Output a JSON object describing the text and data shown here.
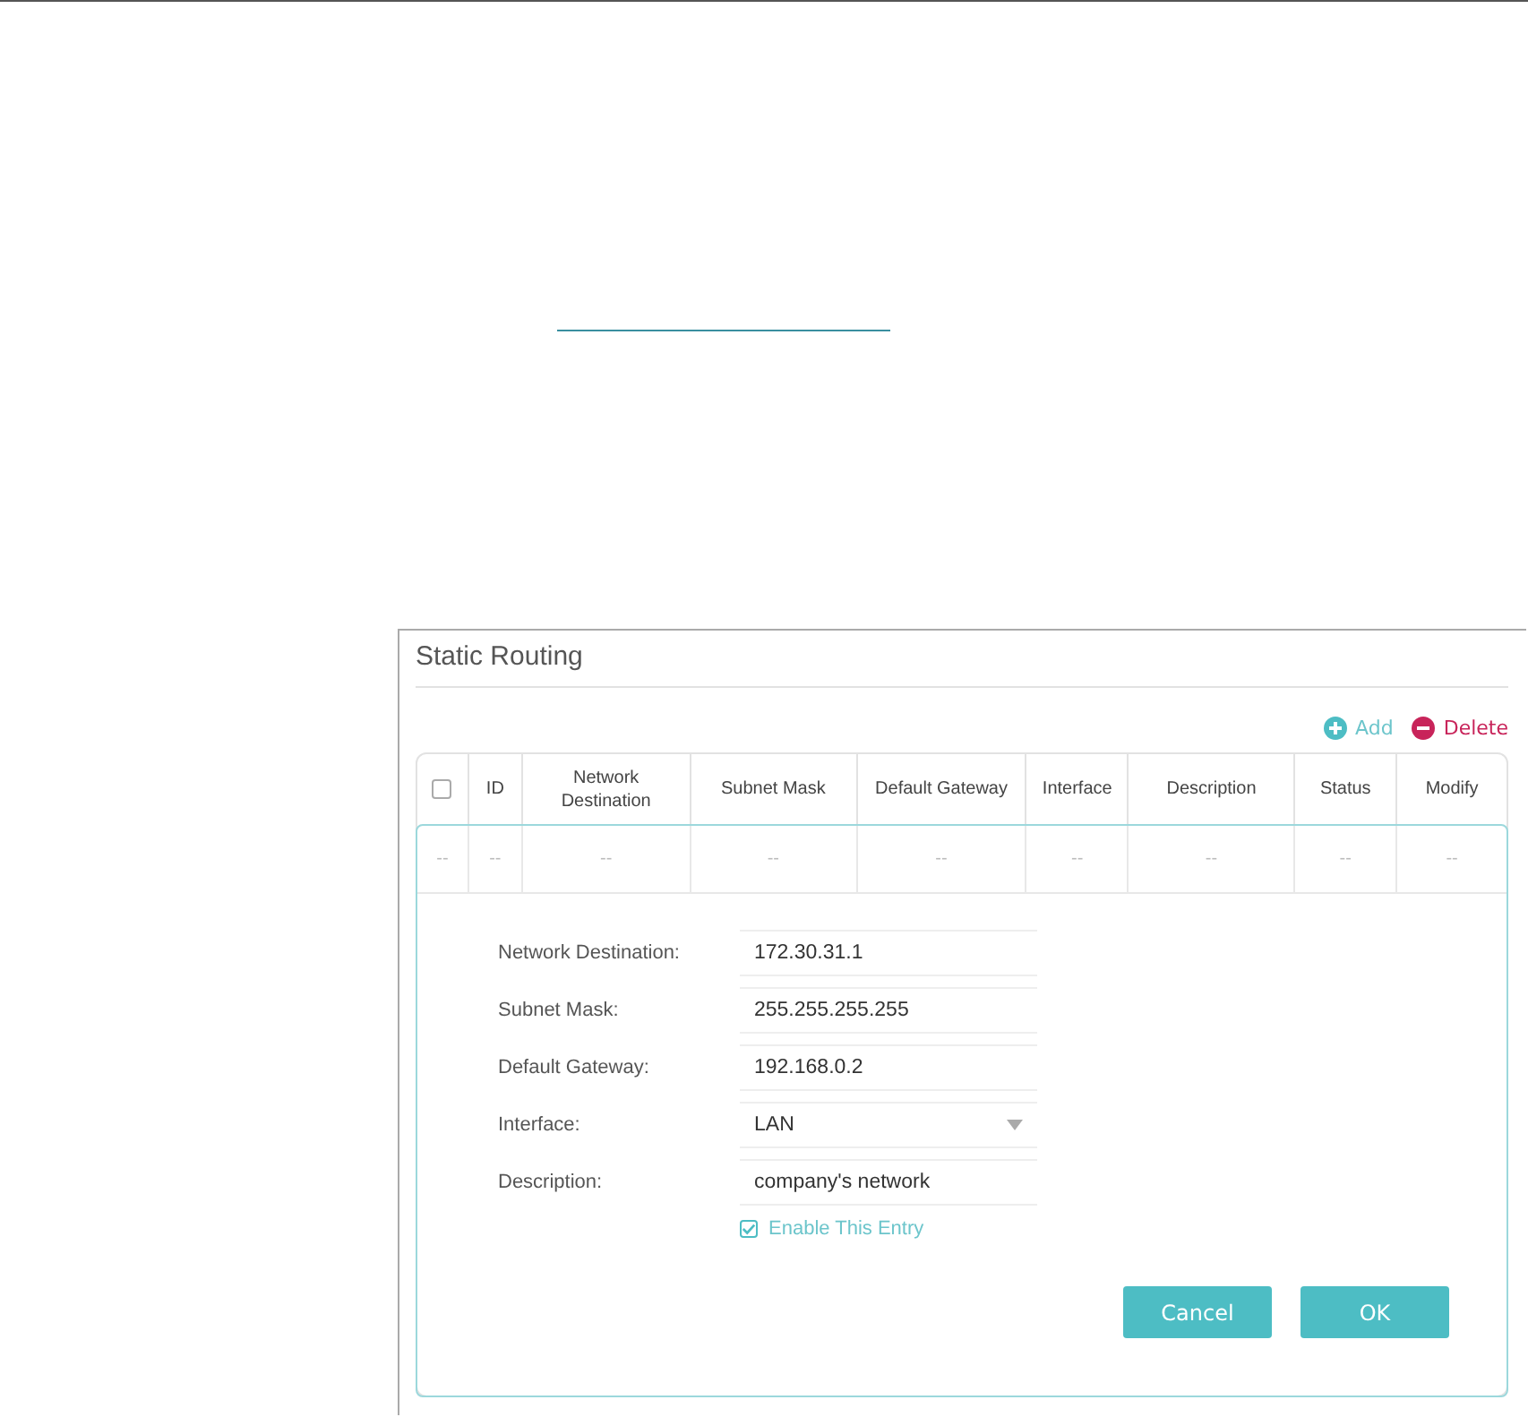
{
  "title": "Static Routing",
  "actions": [
    {
      "label": "Add",
      "kind": "add"
    },
    {
      "label": "Delete",
      "kind": "delete"
    }
  ],
  "table": {
    "select_all": {
      "checked": false
    },
    "columns": [
      "",
      "ID",
      "Network Destination",
      "Subnet Mask",
      "Default Gateway",
      "Interface",
      "Description",
      "Status",
      "Modify"
    ],
    "rows": [
      {
        "cells": [
          "--",
          "--",
          "--",
          "--",
          "--",
          "--",
          "--",
          "--",
          "--"
        ]
      }
    ]
  },
  "form": {
    "fields": [
      {
        "label": "Network Destination:",
        "value": "172.30.31.1",
        "kind": "text"
      },
      {
        "label": "Subnet Mask:",
        "value": "255.255.255.255",
        "kind": "text"
      },
      {
        "label": "Default Gateway:",
        "value": "192.168.0.2",
        "kind": "text"
      },
      {
        "label": "Interface:",
        "value": "LAN",
        "kind": "select"
      },
      {
        "label": "Description:",
        "value": "company's network",
        "kind": "text"
      }
    ],
    "enable": {
      "label": "Enable This Entry",
      "checked": true
    },
    "buttons": [
      "Cancel",
      "OK"
    ]
  }
}
